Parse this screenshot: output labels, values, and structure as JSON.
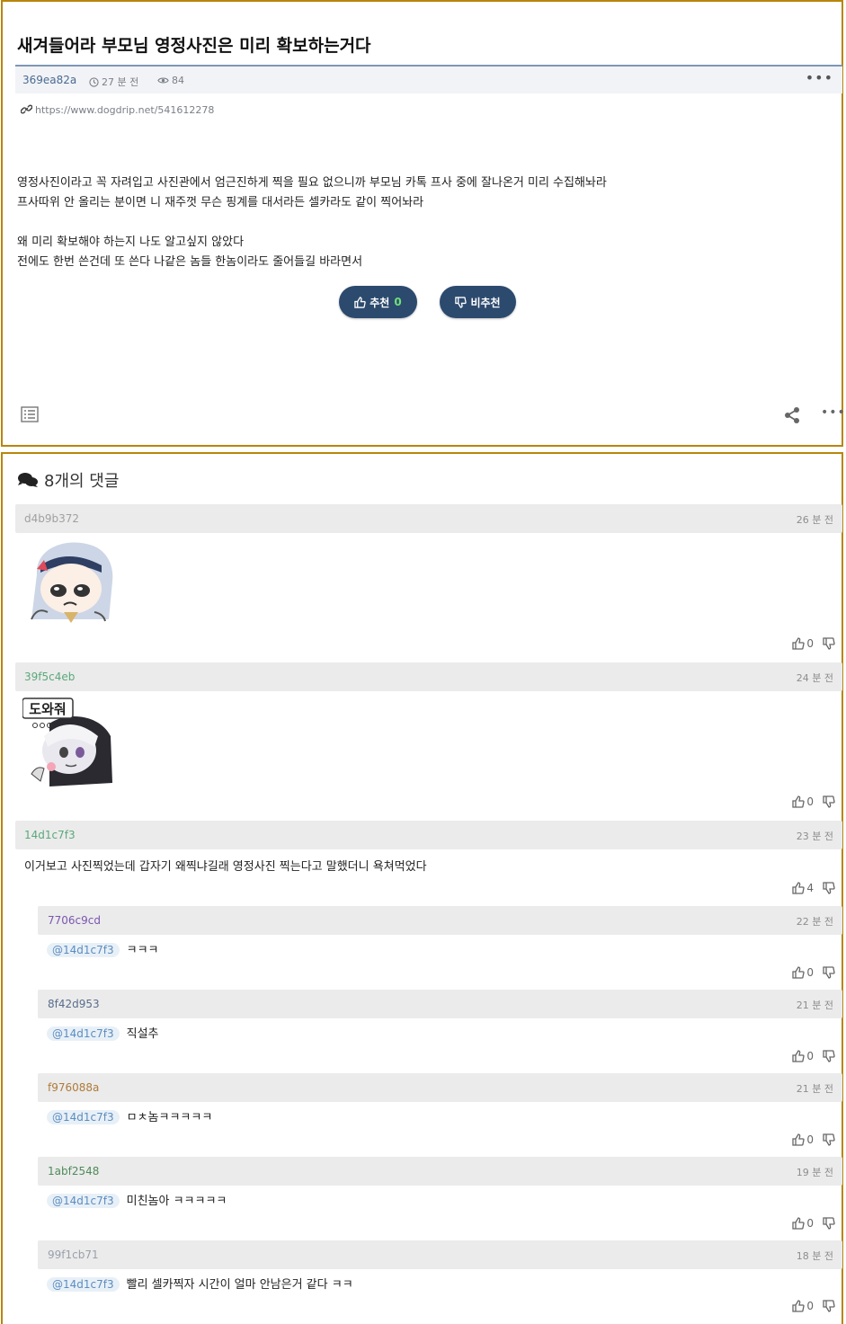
{
  "post": {
    "title": "새겨들어라 부모님 영정사진은 미리 확보하는거다",
    "author": "369ea82a",
    "time": "27 분 전",
    "views": "84",
    "url": "https://www.dogdrip.net/541612278",
    "body": [
      "영정사진이라고 꼭 자려입고 사진관에서 엄근진하게 찍을 필요 없으니까 부모님 카톡 프사 중에 잘나온거 미리 수집해놔라",
      "프사따위 안 올리는 분이면 니 재주껏 무슨 핑계를 대서라든 셀카라도 같이 찍어놔라",
      "왜 미리 확보해야 하는지 나도 알고싶지 않았다",
      "전에도 한번 쓴건데 또 쓴다 나같은 놈들 한놈이라도 줄어들길 바라면서"
    ],
    "upvote_label": "추천",
    "upvote_count": "0",
    "downvote_label": "비추천"
  },
  "comments": {
    "header": "8개의 댓글",
    "items": [
      {
        "author": "d4b9b372",
        "time": "26 분 전",
        "sticker": "sticker-crying-girl",
        "up": "0",
        "author_color": "#a0a0a0"
      },
      {
        "author": "39f5c4eb",
        "time": "24 분 전",
        "sticker": "sticker-girl-with-text",
        "sticker_text": "도와줘",
        "up": "0",
        "author_color": "#5aa87a"
      },
      {
        "author": "14d1c7f3",
        "time": "23 분 전",
        "text": "이거보고 사진찍었는데 갑자기 왜찍냐길래 영정사진 찍는다고 말했더니 욕쳐먹었다",
        "up": "4",
        "author_color": "#5aa87a"
      },
      {
        "author": "7706c9cd",
        "time": "22 분 전",
        "mention": "@14d1c7f3",
        "text": "ㅋㅋㅋ",
        "up": "0",
        "author_color": "#7a56b0"
      },
      {
        "author": "8f42d953",
        "time": "21 분 전",
        "mention": "@14d1c7f3",
        "text": "직설추",
        "up": "0",
        "author_color": "#5a6d8c"
      },
      {
        "author": "f976088a",
        "time": "21 분 전",
        "mention": "@14d1c7f3",
        "text": "ㅁㅊ놈ㅋㅋㅋㅋㅋ",
        "up": "0",
        "author_color": "#b07a3a"
      },
      {
        "author": "1abf2548",
        "time": "19 분 전",
        "mention": "@14d1c7f3",
        "text": "미친놈아 ㅋㅋㅋㅋㅋ",
        "up": "0",
        "author_color": "#4f8a5a"
      },
      {
        "author": "99f1cb71",
        "time": "18 분 전",
        "mention": "@14d1c7f3",
        "text": "빨리 셀카찍자 시간이 얼마 안남은거 같다 ㅋㅋ",
        "up": "0",
        "author_color": "#9aa0aa"
      }
    ]
  },
  "icons": {
    "clock": "clock-icon",
    "eye": "eye-icon",
    "link": "link-icon",
    "thumb_up": "thumb-up-icon",
    "thumb_down": "thumb-down-icon",
    "list": "list-icon",
    "share": "share-icon",
    "more": "more-icon",
    "comments": "comments-icon"
  },
  "colors": {
    "accent": "#2c4a6e",
    "vote_count": "#6ee07a",
    "border": "#b8860b"
  }
}
